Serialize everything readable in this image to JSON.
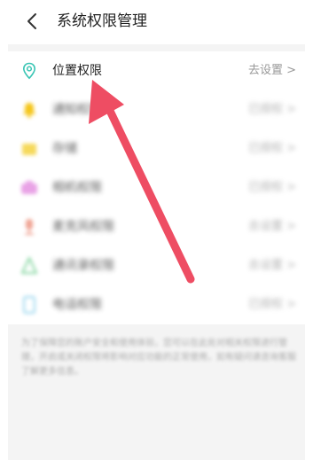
{
  "header": {
    "title": "系统权限管理",
    "back_icon": "chevron-left-icon"
  },
  "permissions": [
    {
      "label": "位置权限",
      "value": "去设置 >",
      "icon": "location-pin-icon",
      "color": "#39c5b4"
    },
    {
      "label": "通知权限",
      "value": "已授权 >",
      "icon": "bell-icon",
      "color": "#f5c518"
    },
    {
      "label": "存储",
      "value": "已授权 >",
      "icon": "folder-icon",
      "color": "#f6d95b"
    },
    {
      "label": "相机权限",
      "value": "已授权 >",
      "icon": "camera-icon",
      "color": "#e9a2e6"
    },
    {
      "label": "麦克风权限",
      "value": "去设置 >",
      "icon": "microphone-icon",
      "color": "#f0a494"
    },
    {
      "label": "通讯录权限",
      "value": "去设置 >",
      "icon": "contacts-icon",
      "color": "#8fd9a8"
    },
    {
      "label": "电话权限",
      "value": "已授权 >",
      "icon": "phone-icon",
      "color": "#9fd8ef"
    }
  ],
  "note": "为了保障您的账户安全和使用体验，您可以在此处对相关权限进行管理，开启或关闭权限将影响对应功能的正常使用，如有疑问请咨询客服了解更多信息。",
  "annotation_color": "#ee4d63"
}
